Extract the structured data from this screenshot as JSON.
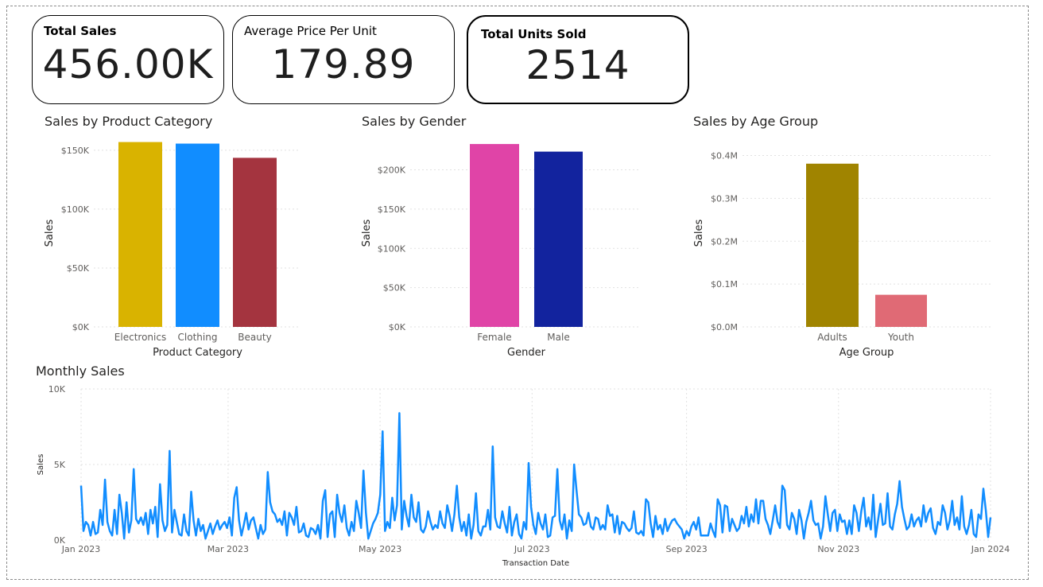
{
  "kpis": {
    "total_sales": {
      "label": "Total Sales",
      "value": "456.00K"
    },
    "avg_price": {
      "label": "Average Price Per Unit",
      "value": "179.89"
    },
    "units": {
      "label": "Total Units Sold",
      "value": "2514"
    }
  },
  "colors": {
    "electronics": "#D9B300",
    "clothing": "#118DFF",
    "beauty": "#A4343F",
    "female": "#E044A7",
    "male": "#12239E",
    "adults": "#A08400",
    "youth": "#E06A75",
    "line": "#118DFF"
  },
  "chart_data": [
    {
      "type": "bar",
      "title": "Sales by Product Category",
      "xlabel": "Product Category",
      "ylabel": "Sales",
      "categories": [
        "Electronics",
        "Clothing",
        "Beauty"
      ],
      "values": [
        156905,
        155580,
        143515
      ],
      "ylim": [
        0,
        160000
      ],
      "yticks": [
        0,
        50000,
        100000,
        150000
      ],
      "ytick_labels": [
        "$0K",
        "$50K",
        "$100K",
        "$150K"
      ],
      "grid": true
    },
    {
      "type": "bar",
      "title": "Sales by Gender",
      "xlabel": "Gender",
      "ylabel": "Sales",
      "categories": [
        "Female",
        "Male"
      ],
      "values": [
        232840,
        223160
      ],
      "ylim": [
        0,
        240000
      ],
      "yticks": [
        0,
        50000,
        100000,
        150000,
        200000
      ],
      "ytick_labels": [
        "$0K",
        "$50K",
        "$100K",
        "$150K",
        "$200K"
      ],
      "grid": true
    },
    {
      "type": "bar",
      "title": "Sales by Age Group",
      "xlabel": "Age Group",
      "ylabel": "Sales",
      "categories": [
        "Adults",
        "Youth"
      ],
      "values": [
        381000,
        75000
      ],
      "ylim": [
        0,
        440000
      ],
      "yticks": [
        0,
        100000,
        200000,
        300000,
        400000
      ],
      "ytick_labels": [
        "$0.0M",
        "$0.1M",
        "$0.2M",
        "$0.3M",
        "$0.4M"
      ],
      "grid": true
    },
    {
      "type": "line",
      "title": "Monthly Sales",
      "xlabel": "Transaction Date",
      "ylabel": "Sales",
      "x_start": "2023-01-01",
      "x_end": "2024-01-01",
      "ylim": [
        0,
        10000
      ],
      "yticks": [
        0,
        5000,
        10000
      ],
      "ytick_labels": [
        "0K",
        "5K",
        "10K"
      ],
      "xticks": [
        "2023-01-01",
        "2023-03-01",
        "2023-05-01",
        "2023-07-01",
        "2023-09-01",
        "2023-11-01",
        "2024-01-01"
      ],
      "xtick_labels": [
        "Jan 2023",
        "Mar 2023",
        "May 2023",
        "Jul 2023",
        "Sep 2023",
        "Nov 2023",
        "Jan 2024"
      ],
      "grid": true,
      "values": [
        3600,
        600,
        1200,
        1000,
        300,
        1200,
        400,
        500,
        2000,
        1000,
        4000,
        1200,
        600,
        300,
        2000,
        400,
        3000,
        1800,
        100,
        2500,
        500,
        1300,
        4700,
        1400,
        1100,
        1500,
        1000,
        1800,
        400,
        2000,
        1100,
        2200,
        200,
        3700,
        1300,
        600,
        1000,
        5900,
        500,
        2000,
        1200,
        400,
        300,
        1700,
        600,
        300,
        3200,
        1300,
        300,
        1400,
        600,
        1000,
        100,
        600,
        1100,
        400,
        900,
        1300,
        700,
        1000,
        1200,
        800,
        1500,
        300,
        2800,
        3500,
        1300,
        300,
        1000,
        1800,
        700,
        1300,
        1500,
        800,
        100,
        1000,
        400,
        700,
        4500,
        2500,
        1900,
        1700,
        1200,
        1400,
        1000,
        1900,
        300,
        1800,
        1500,
        1000,
        2200,
        500,
        600,
        1100,
        300,
        200,
        800,
        700,
        400,
        1000,
        100,
        2600,
        3300,
        200,
        1700,
        1900,
        200,
        3000,
        1800,
        1200,
        2300,
        800,
        300,
        1200,
        600,
        2600,
        1800,
        800,
        4600,
        1800,
        100,
        600,
        1100,
        1400,
        1800,
        3000,
        7200,
        600,
        1200,
        800,
        2800,
        1300,
        2300,
        8400,
        700,
        2600,
        1600,
        900,
        3000,
        1500,
        1200,
        2500,
        700,
        500,
        900,
        1900,
        1200,
        700,
        1000,
        800,
        1900,
        1100,
        800,
        2300,
        1600,
        600,
        1700,
        3600,
        1500,
        600,
        1200,
        300,
        1700,
        100,
        1000,
        3100,
        600,
        300,
        900,
        900,
        2000,
        700,
        6200,
        1500,
        900,
        800,
        1900,
        1100,
        500,
        2200,
        300,
        1200,
        1700,
        400,
        100,
        1200,
        700,
        5100,
        2200,
        1000,
        400,
        1800,
        1100,
        700,
        1700,
        200,
        300,
        1500,
        1600,
        4700,
        1300,
        700,
        1700,
        100,
        1300,
        600,
        5000,
        3300,
        1700,
        1500,
        1000,
        1100,
        1800,
        900,
        700,
        1500,
        1400,
        700,
        1000,
        700,
        2300,
        1600,
        1700,
        500,
        1600,
        400,
        1200,
        1100,
        800,
        600,
        800,
        1900,
        500,
        400,
        600,
        300,
        2700,
        2500,
        1100,
        200,
        1600,
        700,
        1000,
        400,
        1400,
        600,
        1000,
        1300,
        1400,
        1100,
        900,
        700,
        100,
        600,
        300,
        900,
        1200,
        700,
        1500,
        300,
        300,
        300,
        300,
        1100,
        600,
        200,
        2700,
        2300,
        500,
        2300,
        2200,
        600,
        1400,
        1000,
        600,
        800,
        1600,
        1100,
        2200,
        900,
        1700,
        1200,
        2700,
        1100,
        2600,
        2600,
        1400,
        1000,
        400,
        1300,
        2300,
        1200,
        800,
        3600,
        3300,
        1000,
        700,
        1800,
        1400,
        400,
        2000,
        1300,
        100,
        1200,
        1800,
        2600,
        1300,
        1000,
        1100,
        100,
        900,
        2900,
        1700,
        600,
        1800,
        2000,
        600,
        1700,
        1200,
        1300,
        400,
        1300,
        400,
        2300,
        1800,
        600,
        1900,
        2800,
        900,
        1500,
        700,
        3000,
        200,
        1300,
        2400,
        1000,
        1100,
        3100,
        900,
        700,
        1700,
        2400,
        3900,
        2200,
        1400,
        700,
        900,
        1700,
        900,
        1300,
        1500,
        900,
        2300,
        1200,
        1800,
        2100,
        800,
        400,
        1200,
        1000,
        2300,
        1800,
        700,
        1300,
        2600,
        1000,
        1500,
        700,
        2900,
        900,
        400,
        1000,
        2000,
        400,
        200,
        1700,
        1400,
        3400,
        2000,
        200,
        1500
      ]
    }
  ]
}
